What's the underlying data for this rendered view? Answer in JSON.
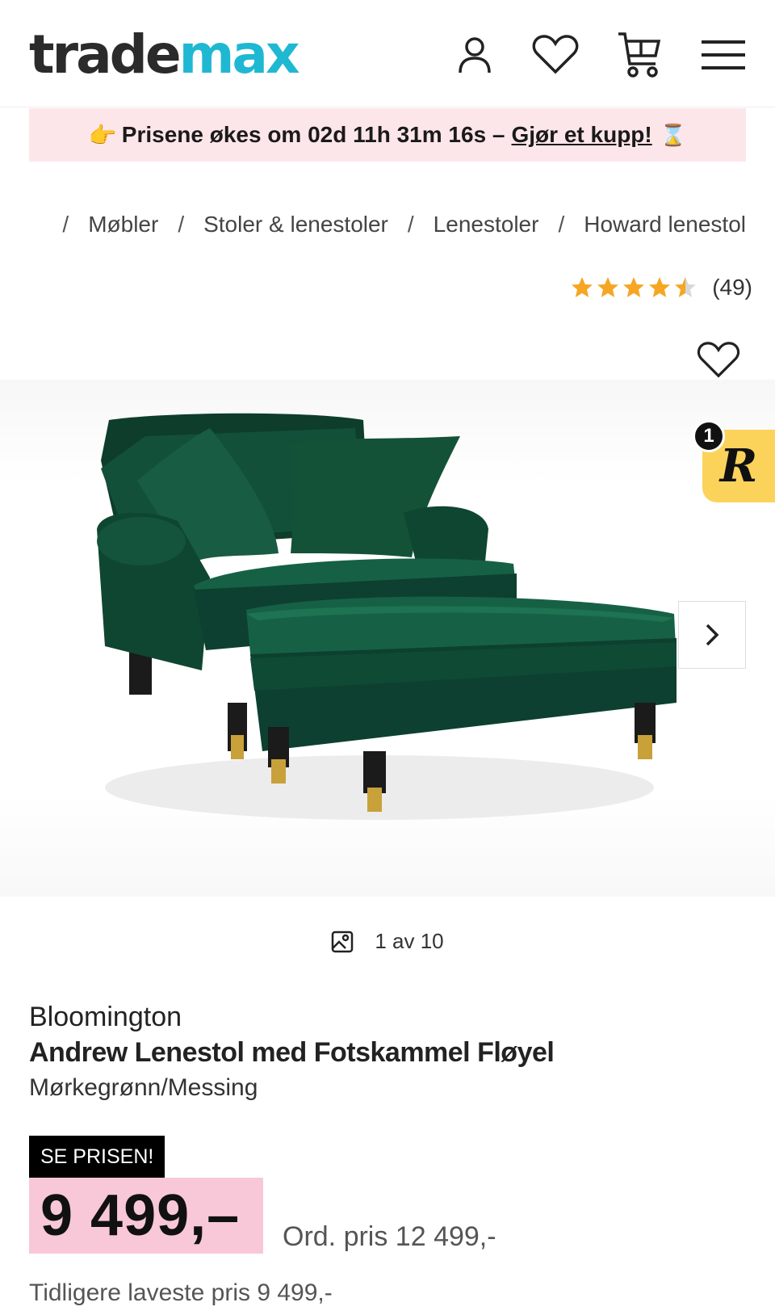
{
  "header": {
    "logo_part1": "trade",
    "logo_part2": "max",
    "icons": [
      "user-icon",
      "heart-icon",
      "cart-icon",
      "menu-icon"
    ]
  },
  "banner": {
    "emoji": "👉",
    "text": "Prisene økes om 02d 11h 31m 16s –",
    "link": "Gjør et kupp!",
    "hourglass": "⌛"
  },
  "breadcrumb": {
    "items": [
      "Møbler",
      "Stoler & lenestoler",
      "Lenestoler",
      "Howard lenestol"
    ],
    "separator": "/"
  },
  "rating": {
    "value": 4.5,
    "count": "(49)",
    "star_color": "#f5a623"
  },
  "gallery": {
    "counter": "1 av 10",
    "badge_count": "1",
    "badge_letter": "R"
  },
  "product": {
    "brand": "Bloomington",
    "title": "Andrew Lenestol med Fotskammel Fløyel",
    "variant": "Mørkegrønn/Messing",
    "promo_label": "SE PRISEN!",
    "price": "9 499,–",
    "ord_price": "Ord. pris 12 499,-",
    "lowest_price": "Tidligere laveste pris 9 499,-"
  },
  "colors": {
    "accent": "#1fb8d2",
    "banner_bg": "#fde6ea",
    "price_bg": "#f8c8d8",
    "sofa": "#0f4a35"
  }
}
